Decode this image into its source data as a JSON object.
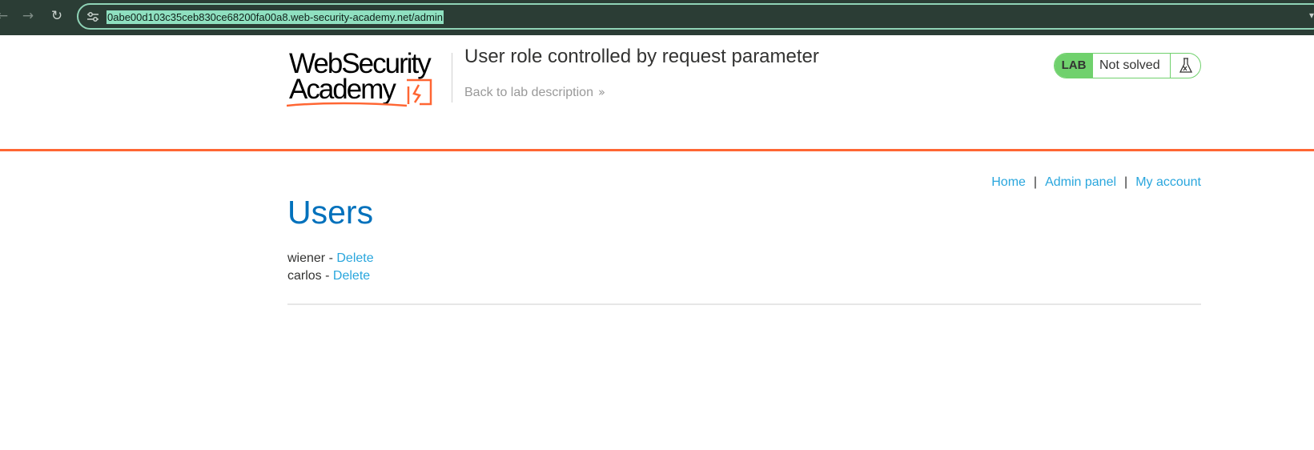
{
  "browser": {
    "back_icon": "arrow-left-icon",
    "forward_icon": "arrow-right-icon",
    "reload_icon": "reload-icon",
    "site_info_icon": "tune-icon",
    "url": "0abe00d103c35ceb830ce68200fa00a8.web-security-academy.net/admin",
    "colors": {
      "toolbar": "#2b3d35",
      "url_highlight": "#8fe0c0"
    }
  },
  "header": {
    "logo": {
      "line1": "WebSecurity",
      "line2": "Academy"
    },
    "title": "User role controlled by request parameter",
    "back_link": "Back to lab description",
    "back_link_icon": "double-chevron-right-icon",
    "lab_badge": "LAB",
    "lab_status": "Not solved",
    "lab_status_icon": "flask-icon",
    "colors": {
      "accent": "#ff6633",
      "lab_green": "#70d16d"
    }
  },
  "nav": {
    "links": [
      "Home",
      "Admin panel",
      "My account"
    ],
    "separator": "|"
  },
  "main": {
    "heading": "Users",
    "users": [
      {
        "name": "wiener",
        "sep": " - ",
        "action": "Delete"
      },
      {
        "name": "carlos",
        "sep": " - ",
        "action": "Delete"
      }
    ],
    "colors": {
      "heading": "#0071bc",
      "link": "#29a6dd"
    }
  }
}
